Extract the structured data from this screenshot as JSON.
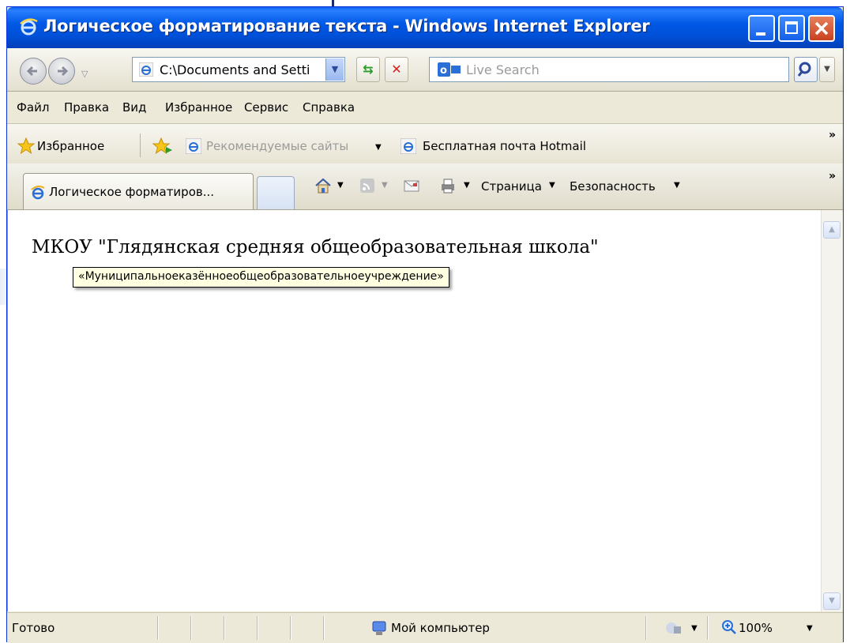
{
  "window": {
    "title": "Логическое форматирование текста - Windows Internet Explorer"
  },
  "address_bar": {
    "url": "C:\\Documents and Setti",
    "search_placeholder": "Live Search"
  },
  "menu": {
    "items": [
      "Файл",
      "Правка",
      "Вид",
      "Избранное",
      "Сервис",
      "Справка"
    ]
  },
  "favorites_bar": {
    "favorites_label": "Избранное",
    "suggested_sites": "Рекомендуемые сайты",
    "hotmail": "Бесплатная почта Hotmail",
    "more": "»"
  },
  "tabs": {
    "active_label": "Логическое форматиров...",
    "page_menu": "Страница",
    "safety_menu": "Безопасность",
    "more": "»"
  },
  "content": {
    "heading": "МКОУ \"Глядянская средняя общеобразовательная школа\"",
    "tooltip": "«Муниципальноеказённоеобщеобразовательноеучреждение»"
  },
  "status_bar": {
    "status": "Готово",
    "zone": "Мой компьютер",
    "zoom": "100%"
  },
  "colors": {
    "titlebar": "#0058e6",
    "tooltip_bg": "#ffffe1",
    "close_button": "#c84020"
  },
  "icons": {
    "title": "ie-logo-icon",
    "back": "back-arrow-icon",
    "forward": "forward-arrow-icon",
    "refresh": "refresh-icon",
    "stop": "stop-icon",
    "search_go": "magnifier-icon",
    "favorites": "star-icon",
    "add_favorites": "add-favorites-icon",
    "home": "home-icon",
    "feeds": "rss-icon",
    "mail": "mail-icon",
    "print": "printer-icon",
    "zone": "computer-icon",
    "zoom": "zoom-icon"
  }
}
